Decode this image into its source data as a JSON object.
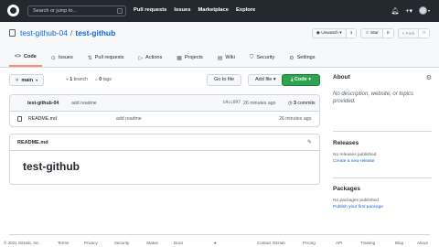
{
  "topbar": {
    "search_placeholder": "Search or jump to...",
    "search_key": "/",
    "nav": [
      "Pull requests",
      "Issues",
      "Marketplace",
      "Explore"
    ]
  },
  "repo": {
    "owner": "test-github-04",
    "separator": "/",
    "name": "test-github",
    "unwatch_label": "Unwatch",
    "unwatch_count": "1",
    "star_label": "Star",
    "star_count": "0",
    "fork_label": "Fork",
    "fork_count": "0"
  },
  "tabs": [
    {
      "label": "Code",
      "icon": "code-icon"
    },
    {
      "label": "Issues",
      "icon": "issue-icon"
    },
    {
      "label": "Pull requests",
      "icon": "pull-request-icon"
    },
    {
      "label": "Actions",
      "icon": "play-icon"
    },
    {
      "label": "Projects",
      "icon": "table-icon"
    },
    {
      "label": "Wiki",
      "icon": "book-icon"
    },
    {
      "label": "Security",
      "icon": "shield-icon"
    },
    {
      "label": "Settings",
      "icon": "gear-icon"
    }
  ],
  "branch_bar": {
    "branch": "main",
    "branch_count": "1",
    "branch_word": "branch",
    "tag_count": "0",
    "tag_word": "tags",
    "goto_label": "Go to file",
    "add_file_label": "Add file",
    "code_label": "Code"
  },
  "commit": {
    "author": "test-github-04",
    "message": "add readme",
    "sha": "b9cc897",
    "time": "26 minutes ago",
    "commits_count": "3",
    "commits_word": "commits"
  },
  "files": [
    {
      "name": "README.md",
      "message": "add readme",
      "time": "26 minutes ago"
    }
  ],
  "readme": {
    "title": "README.md",
    "heading": "test-github"
  },
  "sidebar": {
    "about_title": "About",
    "about_text": "No description, website, or topics provided.",
    "releases_title": "Releases",
    "releases_text": "No releases published",
    "releases_link": "Create a new release",
    "packages_title": "Packages",
    "packages_text": "No packages published",
    "packages_link": "Publish your first package"
  },
  "footer": [
    "© 2021 GitHub, Inc.",
    "Terms",
    "Privacy",
    "Security",
    "Status",
    "Docs",
    "Contact GitHub",
    "Pricing",
    "API",
    "Training",
    "Blog",
    "About"
  ]
}
